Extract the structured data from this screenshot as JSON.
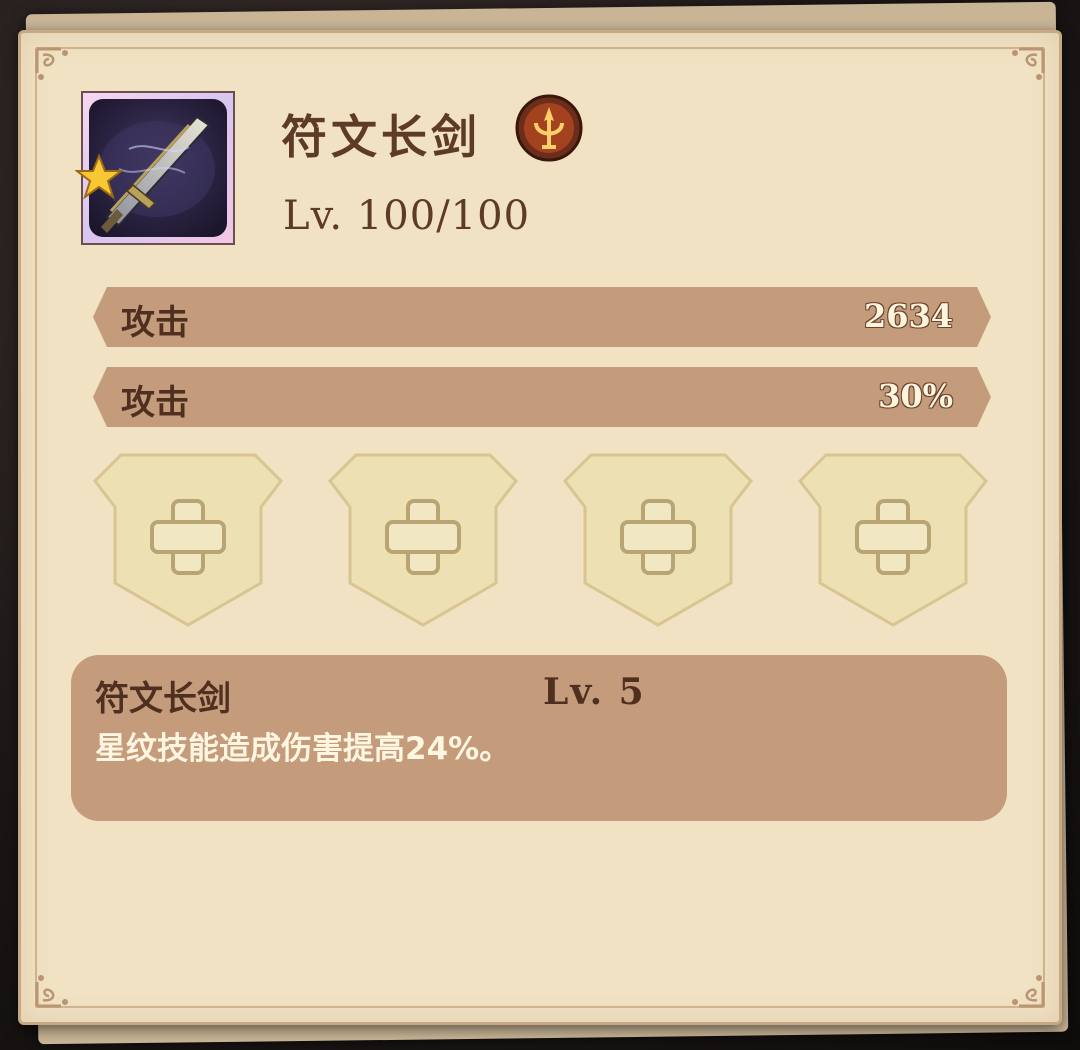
{
  "item": {
    "name": "符文长剑",
    "level_text": "Lv. 100/100",
    "rarity_stars": 1,
    "icons": {
      "item": "runic-longsword-icon",
      "element": "fire-trident-element-icon",
      "rarity": "gold-star-icon"
    }
  },
  "stats": [
    {
      "label": "攻击",
      "value": "2634"
    },
    {
      "label": "攻击",
      "value": "30%"
    }
  ],
  "slots": [
    {
      "icon": "plus-icon"
    },
    {
      "icon": "plus-icon"
    },
    {
      "icon": "plus-icon"
    },
    {
      "icon": "plus-icon"
    }
  ],
  "skill": {
    "name": "符文长剑",
    "level": "Lv. 5",
    "description": "星纹技能造成伤害提高24%。"
  },
  "colors": {
    "panel": "#f1e2c4",
    "stat_bar": "#c49c7b",
    "text_dark": "#5d3b26",
    "text_light": "#fff6e2",
    "slot": "#eee0b3"
  }
}
